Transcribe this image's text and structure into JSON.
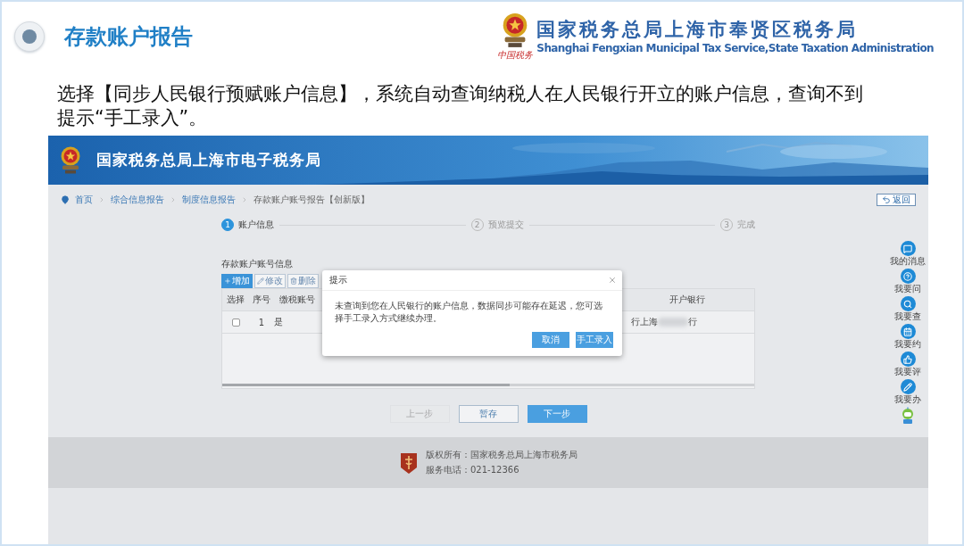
{
  "slide": {
    "title": "存款账户报告",
    "org_name": "国家税务总局上海市奉贤区税务局",
    "org_name_en": "Shanghai Fengxian Municipal Tax Service,State Taxation  Administration",
    "logo_caption": "中国税务",
    "instruction": "选择【同步人民银行预赋账户信息】，系统自动查询纳税人在人民银行开立的账户信息，查询不到提示“手工录入”。"
  },
  "portal": {
    "title": "国家税务总局上海市电子税务局",
    "breadcrumb": [
      "首页",
      "综合信息报告",
      "制度信息报告",
      "存款账户账号报告【创新版】"
    ],
    "back": "返回",
    "steps": [
      {
        "number": "1",
        "label": "账户信息",
        "selected": true
      },
      {
        "number": "2",
        "label": "预览提交",
        "selected": false
      },
      {
        "number": "3",
        "label": "完成",
        "selected": false
      }
    ],
    "section_title": "存款账户账号信息",
    "toolbar": [
      {
        "label": "增加",
        "kind": "add"
      },
      {
        "label": "修改",
        "kind": "edit"
      },
      {
        "label": "删除",
        "kind": "delete"
      }
    ],
    "table": {
      "columns": [
        "选择",
        "序号",
        "缴税账号",
        "开户银行"
      ],
      "rows": [
        {
          "checked": false,
          "number": "1",
          "column_3": "是",
          "bank_start": "行上海",
          "bank_end": "行"
        }
      ]
    },
    "nav_buttons": [
      {
        "label": "上一步",
        "kind": "default",
        "disabled": true
      },
      {
        "label": "暂存",
        "kind": "outline",
        "disabled": false
      },
      {
        "label": "下一步",
        "kind": "primary",
        "disabled": false
      }
    ],
    "footer": {
      "copyright": "版权所有：国家税务总局上海市税务局",
      "phone": "服务电话：021-12366"
    },
    "sidebar": [
      {
        "label": "我的消息",
        "kind": "message"
      },
      {
        "label": "我要问",
        "kind": "ask"
      },
      {
        "label": "我要查",
        "kind": "search"
      },
      {
        "label": "我要约",
        "kind": "calendar"
      },
      {
        "label": "我要评",
        "kind": "rate"
      },
      {
        "label": "我要办",
        "kind": "edit"
      },
      {
        "kind": "robot"
      }
    ],
    "dialog": {
      "title": "提示",
      "message": "未查询到您在人民银行的账户信息，数据同步可能存在延迟，您可选择手工录入方式继续办理。",
      "buttons": [
        "取消",
        "手工录入"
      ]
    }
  }
}
